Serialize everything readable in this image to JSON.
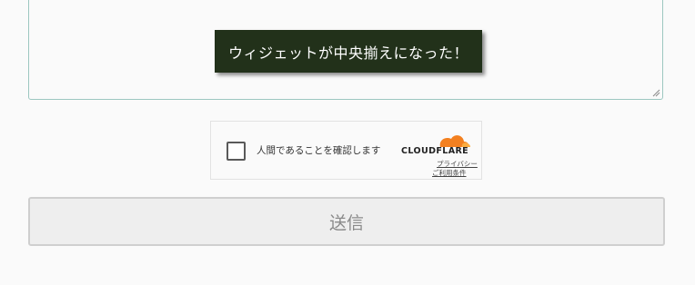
{
  "tooltip": {
    "text": "ウィジェットが中央揃えになった！"
  },
  "turnstile": {
    "checkbox_label": "人間であることを確認します",
    "brand": "CLOUDFLARE",
    "privacy_link": "プライバシー",
    "terms_link": "ご利用条件",
    "brand_color": "#f38020"
  },
  "form": {
    "submit_label": "送信"
  },
  "colors": {
    "textarea_border": "#9cc7c0",
    "tooltip_bg": "#22311a",
    "submit_bg": "#eeeeee"
  }
}
